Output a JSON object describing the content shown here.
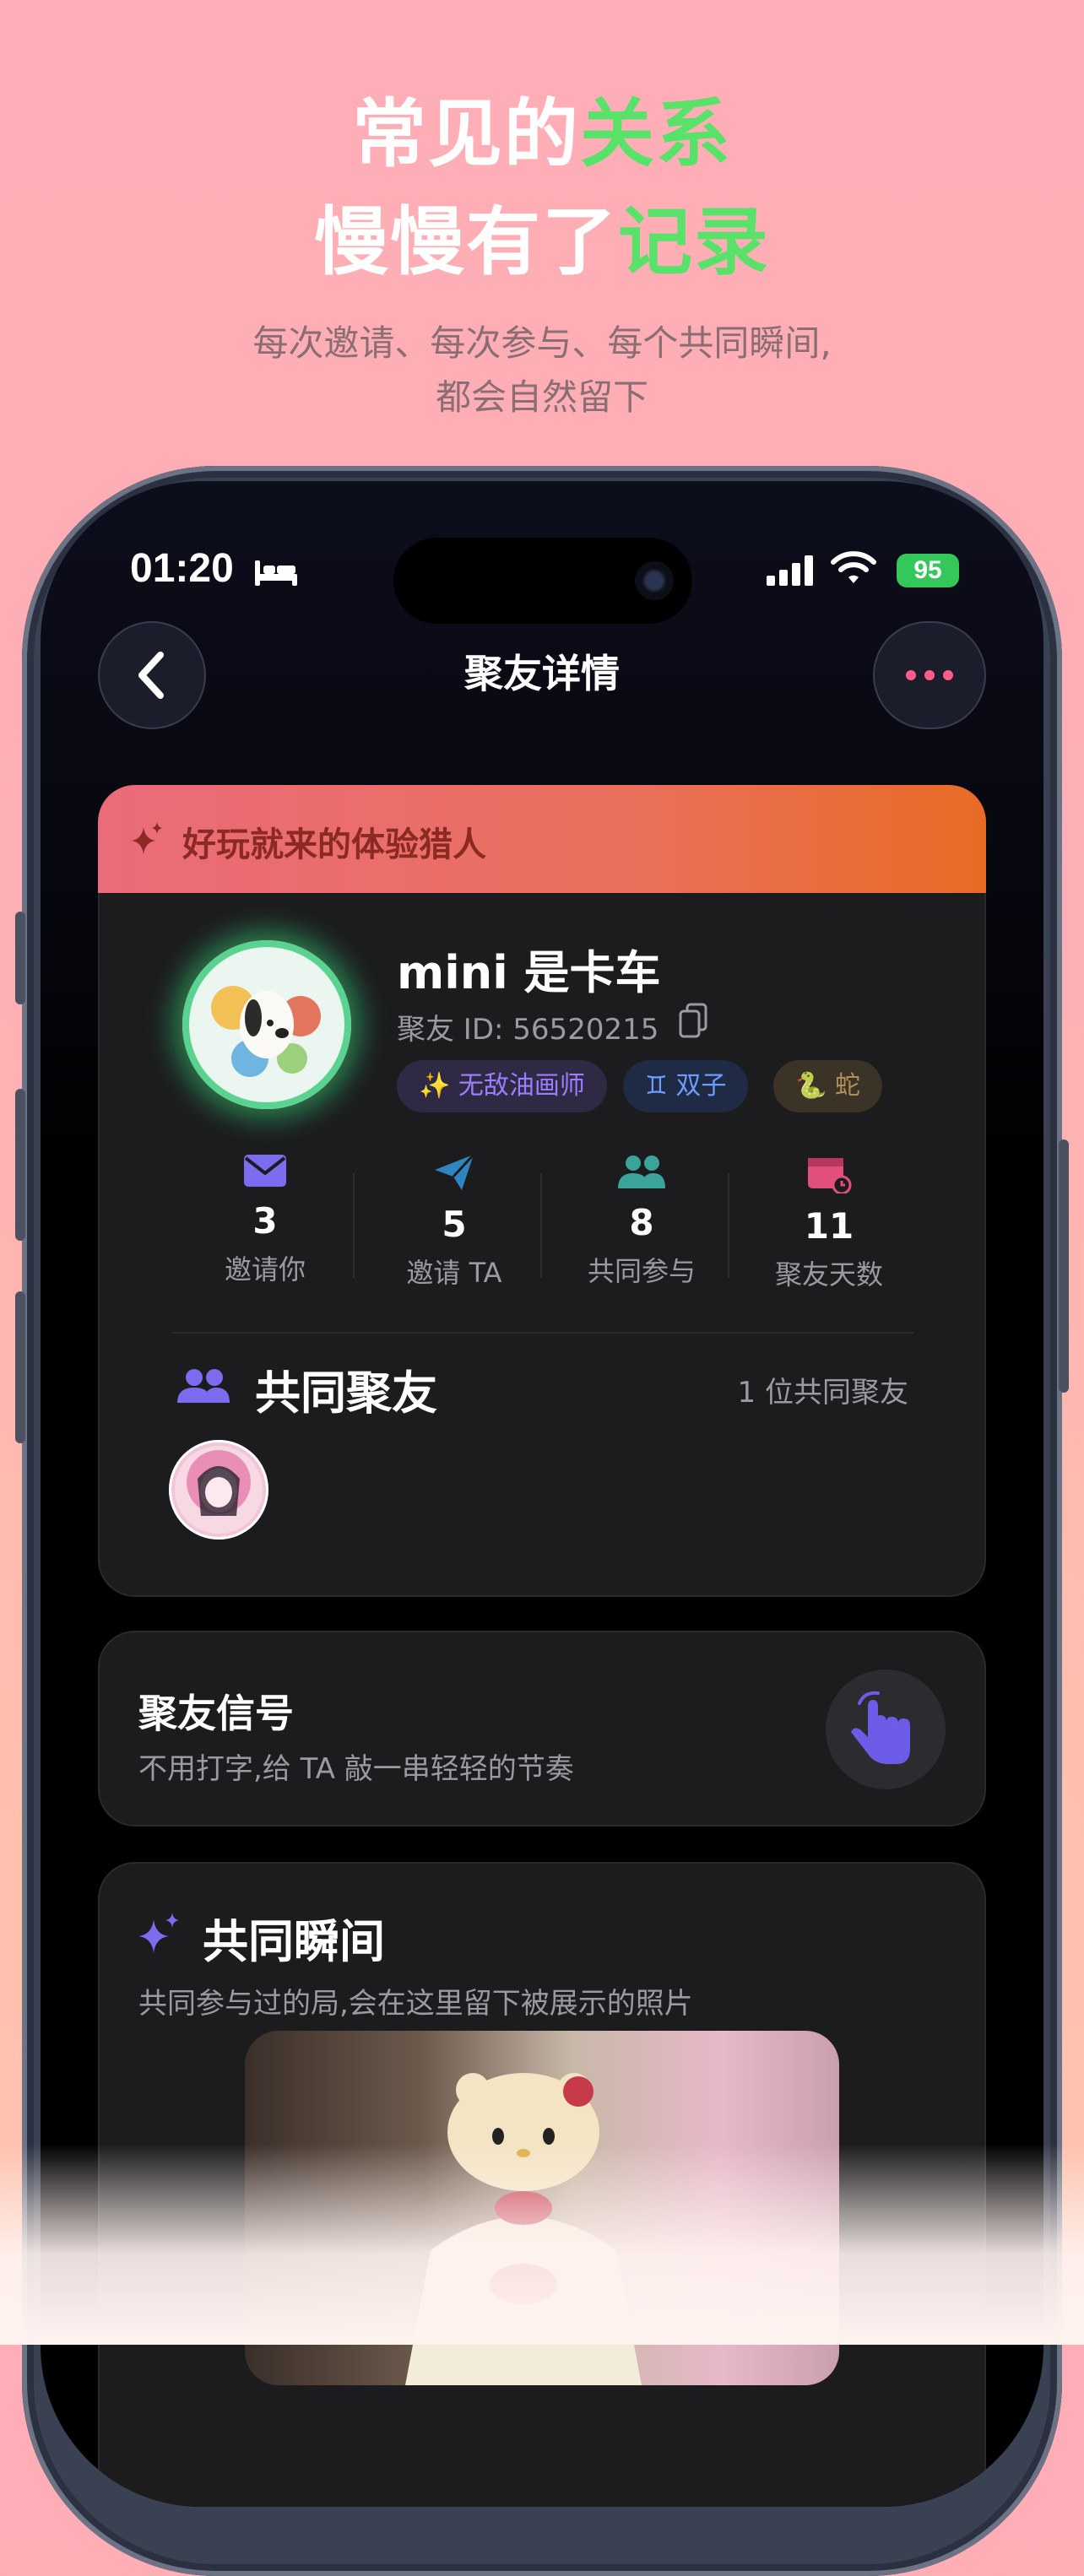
{
  "hero": {
    "line1_a": "常见的",
    "line1_b": "关系",
    "line2_a": "慢慢有了",
    "line2_b": "记录",
    "sub1": "每次邀请、每次参与、每个共同瞬间,",
    "sub2": "都会自然留下"
  },
  "status": {
    "time": "01:20",
    "battery": "95"
  },
  "nav": {
    "title": "聚友详情"
  },
  "profile": {
    "banner": "好玩就来的体验猎人",
    "name": "mini 是卡车",
    "id_label": "聚友 ID:",
    "id_value": "56520215",
    "tags": [
      "✨ 无敌油画师",
      "♊ 双子",
      "🐍 蛇"
    ],
    "stats": [
      {
        "num": "3",
        "label": "邀请你"
      },
      {
        "num": "5",
        "label": "邀请 TA"
      },
      {
        "num": "8",
        "label": "共同参与"
      },
      {
        "num": "11",
        "label": "聚友天数"
      }
    ],
    "mutual_title": "共同聚友",
    "mutual_count": "1 位共同聚友"
  },
  "signal": {
    "title": "聚友信号",
    "sub": "不用打字,给 TA 敲一串轻轻的节奏"
  },
  "moments": {
    "title": "共同瞬间",
    "sub": "共同参与过的局,会在这里留下被展示的照片"
  },
  "colors": {
    "accent_green": "#58e26a",
    "purple": "#7b6cf0",
    "teal": "#3aa39a",
    "pink": "#e0507a"
  }
}
